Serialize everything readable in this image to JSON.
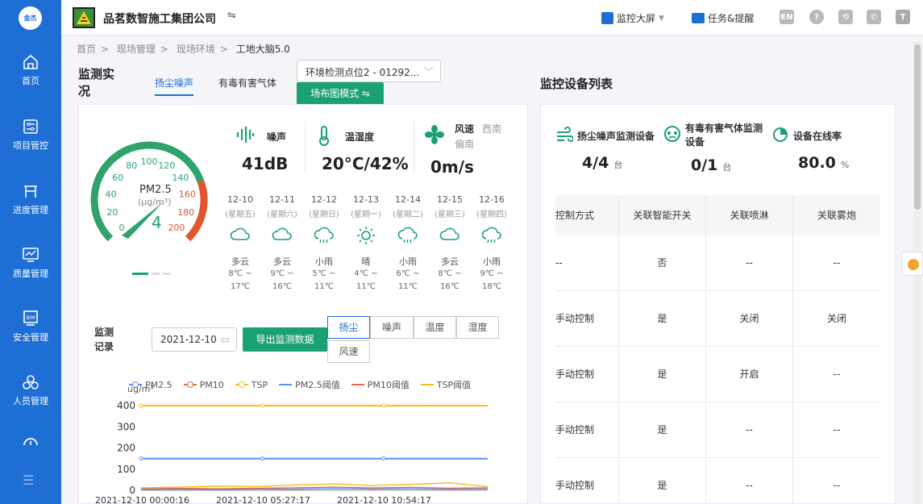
{
  "sidebar": {
    "logo": "金杰",
    "items": [
      {
        "label": "首页",
        "icon": "home-icon"
      },
      {
        "label": "项目管控",
        "icon": "sliders-icon"
      },
      {
        "label": "进度管理",
        "icon": "progress-icon"
      },
      {
        "label": "质量管理",
        "icon": "monitor-icon"
      },
      {
        "label": "安全管理",
        "icon": "bim-icon"
      },
      {
        "label": "人员管理",
        "icon": "people-icon"
      }
    ],
    "bim_text": "BIM",
    "menu_icon": "☰"
  },
  "topbar": {
    "company": "品茗数智施工集团公司",
    "switch_icon": "⇋",
    "monitor_screen": "监控大屏",
    "tasks": "任务&提醒",
    "lang": "EN",
    "help": "?"
  },
  "breadcrumb": [
    "首页",
    "现场管理",
    "现场环境",
    "工地大脑5.0"
  ],
  "left": {
    "title_line1": "监测实",
    "title_line2": "况",
    "tabs": [
      "扬尘噪声",
      "有毒有害气体"
    ],
    "station_select": "环境检测点位2 - 01292...",
    "layout_mode_btn": "场布图模式 ⇋",
    "gauge": {
      "label": "PM2.5",
      "unit": "(μg/m³)",
      "value": "4",
      "numeric_value": 4,
      "max": 200,
      "ticks": [
        "0",
        "20",
        "40",
        "60",
        "80",
        "100",
        "120",
        "140",
        "160",
        "180",
        "200"
      ]
    },
    "noise": {
      "label": "噪声",
      "value": "41dB"
    },
    "temp": {
      "label": "温湿度",
      "value": "20°C/42%"
    },
    "wind": {
      "label": "风速",
      "dir": "西南偏南",
      "value": "0m/s"
    },
    "forecast": [
      {
        "date": "12-10",
        "weekday": "(星期五)",
        "cond": "多云",
        "icon": "cloud",
        "hi": "8℃ ~",
        "lo": "17℃"
      },
      {
        "date": "12-11",
        "weekday": "(星期六)",
        "cond": "多云",
        "icon": "cloud",
        "hi": "9℃ ~",
        "lo": "16℃"
      },
      {
        "date": "12-12",
        "weekday": "(星期日)",
        "cond": "小雨",
        "icon": "rain",
        "hi": "5℃ ~",
        "lo": "11℃"
      },
      {
        "date": "12-13",
        "weekday": "(星期一)",
        "cond": "晴",
        "icon": "sun",
        "hi": "4℃ ~",
        "lo": "11℃"
      },
      {
        "date": "12-14",
        "weekday": "(星期二)",
        "cond": "小雨",
        "icon": "rain",
        "hi": "6℃ ~",
        "lo": "11℃"
      },
      {
        "date": "12-15",
        "weekday": "(星期三)",
        "cond": "多云",
        "icon": "cloud",
        "hi": "8℃ ~",
        "lo": "16℃"
      },
      {
        "date": "12-16",
        "weekday": "(星期四)",
        "cond": "小雨",
        "icon": "rain",
        "hi": "9℃ ~",
        "lo": "18℃"
      }
    ],
    "record_title_1": "监测",
    "record_title_2": "记录",
    "date": "2021-12-10",
    "export_btn": "导出监测数据",
    "segments": [
      "扬尘",
      "噪声",
      "温度",
      "湿度",
      "风速"
    ]
  },
  "chart_data": {
    "type": "line",
    "ylabel": "ug/m³",
    "ylim": [
      0,
      450
    ],
    "yticks": [
      0,
      100,
      200,
      300,
      400
    ],
    "xticks": [
      "2021-12-10 00:00:16",
      "2021-12-10 05:27:17",
      "2021-12-10 10:54:17"
    ],
    "series": [
      {
        "name": "PM2.5",
        "color": "#5b8ff9",
        "values": [
          4,
          5,
          4,
          6,
          5,
          8,
          6,
          7,
          5,
          6
        ]
      },
      {
        "name": "PM10",
        "color": "#e8684a",
        "values": [
          8,
          9,
          7,
          10,
          12,
          15,
          11,
          14,
          10,
          12
        ]
      },
      {
        "name": "TSP",
        "color": "#f6bd16",
        "values": [
          12,
          15,
          20,
          18,
          25,
          30,
          22,
          28,
          35,
          18
        ]
      },
      {
        "name": "PM2.5阈值",
        "color": "#5b8ff9",
        "values": [
          150,
          150,
          150,
          150,
          150,
          150,
          150,
          150,
          150,
          150
        ]
      },
      {
        "name": "PM10阈值",
        "color": "#e8684a",
        "values": [
          0,
          0,
          0,
          0,
          0,
          0,
          0,
          0,
          0,
          0
        ]
      },
      {
        "name": "TSP阈值",
        "color": "#f6bd16",
        "values": [
          400,
          400,
          400,
          400,
          400,
          400,
          400,
          400,
          400,
          400
        ]
      }
    ]
  },
  "right": {
    "title": "监控设备列表",
    "stats": [
      {
        "label": "扬尘噪声监测设备",
        "value": "4/4",
        "unit": "台"
      },
      {
        "label": "有毒有害气体监测设备",
        "value": "0/1",
        "unit": "台"
      },
      {
        "label": "设备在线率",
        "value": "80.0",
        "unit": "%"
      }
    ],
    "table_headers": [
      "控制方式",
      "关联智能开关",
      "关联喷淋",
      "关联雾炮"
    ],
    "rows": [
      [
        "--",
        "否",
        "--",
        "--"
      ],
      [
        "手动控制",
        "是",
        "关闭",
        "关闭"
      ],
      [
        "手动控制",
        "是",
        "开启",
        "--"
      ],
      [
        "手动控制",
        "是",
        "--",
        "--"
      ],
      [
        "手动控制",
        "是",
        "--",
        "--"
      ]
    ]
  }
}
